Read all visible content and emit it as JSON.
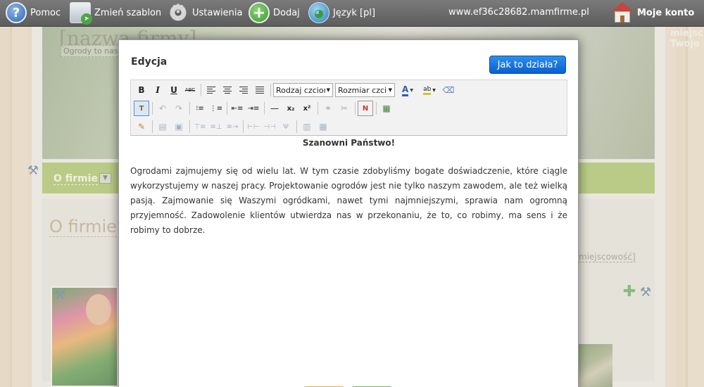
{
  "topbar": {
    "help_label": "Pomoc",
    "template_label": "Zmień szablon",
    "settings_label": "Ustawienia",
    "add_label": "Dodaj",
    "language_label": "Język [pl]",
    "domain": "www.ef36c28682.mamfirme.pl",
    "account_label": "Moje konto",
    "icons": [
      "help-icon",
      "template-icon",
      "gear-icon",
      "add-icon",
      "globe-icon",
      "home-icon"
    ]
  },
  "site": {
    "header_ghost": "[nazwa firmy]",
    "header_sub": "Ogrody to nasz",
    "right_ghost_1": "miejsc",
    "right_ghost_2": "Twoje",
    "nav_item": "O firmie",
    "section_title": "O firmie",
    "location": "miejscowość]",
    "colors": {
      "nav_green": "#9ebc56",
      "title_tan": "#b69f7b"
    }
  },
  "modal": {
    "title": "Edycja",
    "help_button": "Jak to działa?",
    "font_family_select": "Rodzaj czcionki",
    "font_size_select": "Rozmiar czcionki",
    "toolbar_buttons": {
      "bold": "B",
      "italic": "I",
      "underline": "U",
      "strikethrough": "ABC",
      "subscript": "x₂",
      "superscript": "x²"
    },
    "content": {
      "heading": "Szanowni Państwo!",
      "paragraph": "Ogrodami zajmujemy się od wielu lat. W tym czasie zdobyliśmy  bogate doświadczenie, które ciągle wykorzystujemy w naszej pracy. Projektowanie ogrodów jest nie tylko naszym zawodem, ale też wielką pasją. Zajmowanie się Waszymi ogródkami, nawet tymi najmniejszymi, sprawia nam ogromną przyjemność. Zadowolenie klientów utwierdza nas w przekonaniu, że to, co robimy, ma sens i że robimy to dobrze."
    },
    "colors": {
      "button_blue": "#1a78e0"
    }
  }
}
